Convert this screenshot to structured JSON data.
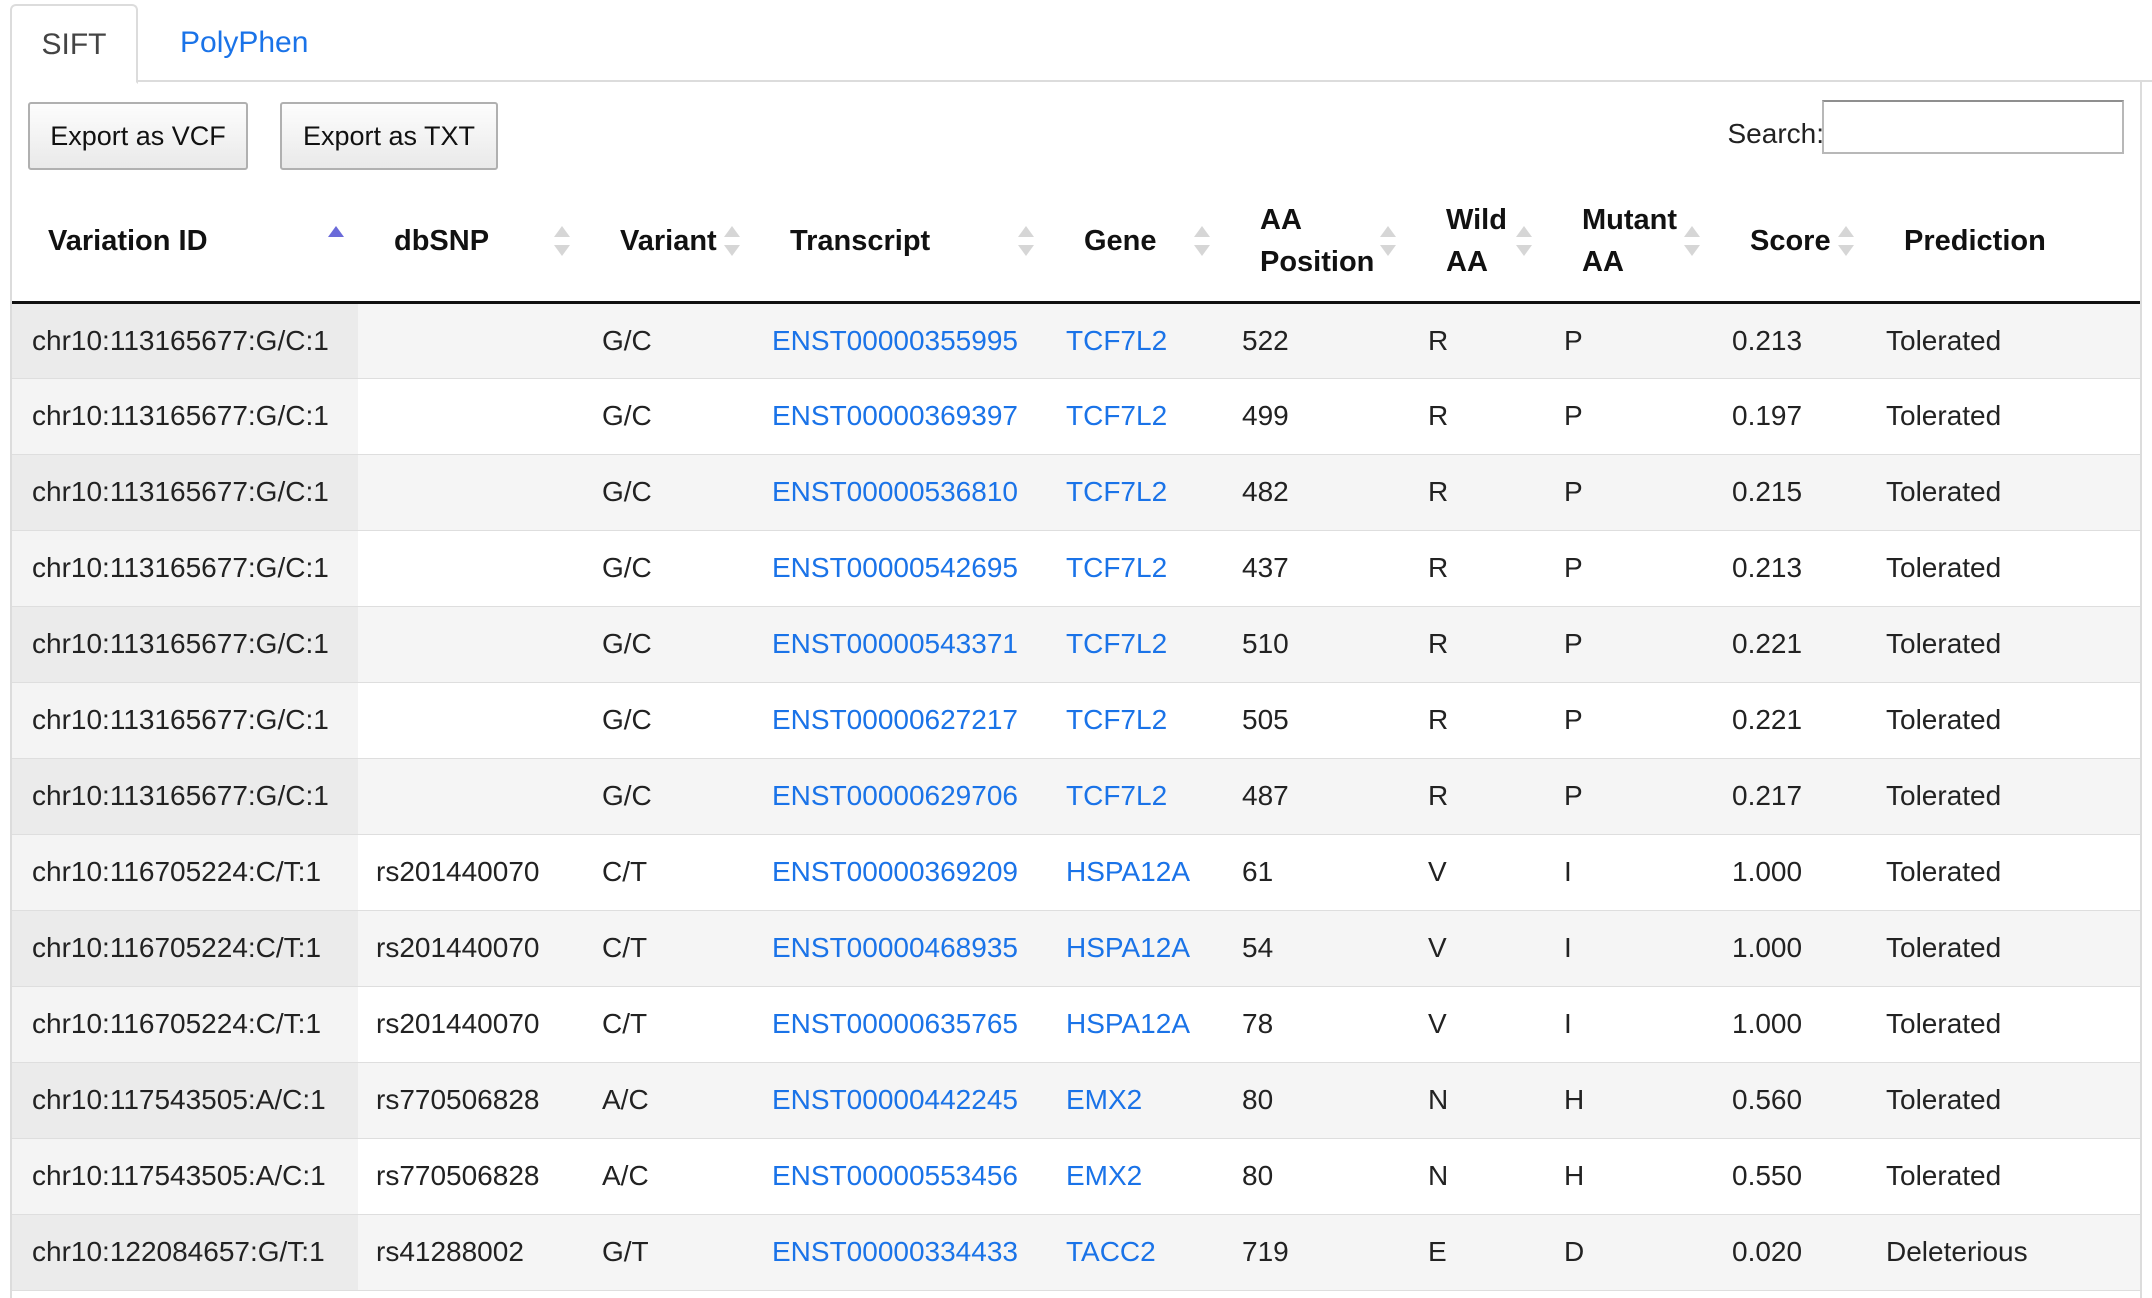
{
  "tabs": [
    {
      "label": "SIFT",
      "active": true
    },
    {
      "label": "PolyPhen",
      "active": false
    }
  ],
  "toolbar": {
    "export_vcf": "Export as VCF",
    "export_txt": "Export as TXT",
    "search_label": "Search:",
    "search_value": ""
  },
  "table": {
    "columns": [
      {
        "label": "Variation ID",
        "sort": "asc"
      },
      {
        "label": "dbSNP",
        "sort": "none"
      },
      {
        "label": "Variant",
        "sort": "none"
      },
      {
        "label": "Transcript",
        "sort": "none"
      },
      {
        "label": "Gene",
        "sort": "none"
      },
      {
        "label": "AA Position",
        "sort": "none"
      },
      {
        "label": "Wild AA",
        "sort": "none"
      },
      {
        "label": "Mutant AA",
        "sort": "none"
      },
      {
        "label": "Score",
        "sort": "none"
      },
      {
        "label": "Prediction",
        "sort": "none"
      }
    ],
    "rows": [
      [
        "chr10:113165677:G/C:1",
        "",
        "G/C",
        "ENST00000355995",
        "TCF7L2",
        "522",
        "R",
        "P",
        "0.213",
        "Tolerated"
      ],
      [
        "chr10:113165677:G/C:1",
        "",
        "G/C",
        "ENST00000369397",
        "TCF7L2",
        "499",
        "R",
        "P",
        "0.197",
        "Tolerated"
      ],
      [
        "chr10:113165677:G/C:1",
        "",
        "G/C",
        "ENST00000536810",
        "TCF7L2",
        "482",
        "R",
        "P",
        "0.215",
        "Tolerated"
      ],
      [
        "chr10:113165677:G/C:1",
        "",
        "G/C",
        "ENST00000542695",
        "TCF7L2",
        "437",
        "R",
        "P",
        "0.213",
        "Tolerated"
      ],
      [
        "chr10:113165677:G/C:1",
        "",
        "G/C",
        "ENST00000543371",
        "TCF7L2",
        "510",
        "R",
        "P",
        "0.221",
        "Tolerated"
      ],
      [
        "chr10:113165677:G/C:1",
        "",
        "G/C",
        "ENST00000627217",
        "TCF7L2",
        "505",
        "R",
        "P",
        "0.221",
        "Tolerated"
      ],
      [
        "chr10:113165677:G/C:1",
        "",
        "G/C",
        "ENST00000629706",
        "TCF7L2",
        "487",
        "R",
        "P",
        "0.217",
        "Tolerated"
      ],
      [
        "chr10:116705224:C/T:1",
        "rs201440070",
        "C/T",
        "ENST00000369209",
        "HSPA12A",
        "61",
        "V",
        "I",
        "1.000",
        "Tolerated"
      ],
      [
        "chr10:116705224:C/T:1",
        "rs201440070",
        "C/T",
        "ENST00000468935",
        "HSPA12A",
        "54",
        "V",
        "I",
        "1.000",
        "Tolerated"
      ],
      [
        "chr10:116705224:C/T:1",
        "rs201440070",
        "C/T",
        "ENST00000635765",
        "HSPA12A",
        "78",
        "V",
        "I",
        "1.000",
        "Tolerated"
      ],
      [
        "chr10:117543505:A/C:1",
        "rs770506828",
        "A/C",
        "ENST00000442245",
        "EMX2",
        "80",
        "N",
        "H",
        "0.560",
        "Tolerated"
      ],
      [
        "chr10:117543505:A/C:1",
        "rs770506828",
        "A/C",
        "ENST00000553456",
        "EMX2",
        "80",
        "N",
        "H",
        "0.550",
        "Tolerated"
      ],
      [
        "chr10:122084657:G/T:1",
        "rs41288002",
        "G/T",
        "ENST00000334433",
        "TACC2",
        "719",
        "E",
        "D",
        "0.020",
        "Deleterious"
      ]
    ]
  },
  "colors": {
    "link": "#1a73e8",
    "sort_active": "#6a6ad9"
  }
}
